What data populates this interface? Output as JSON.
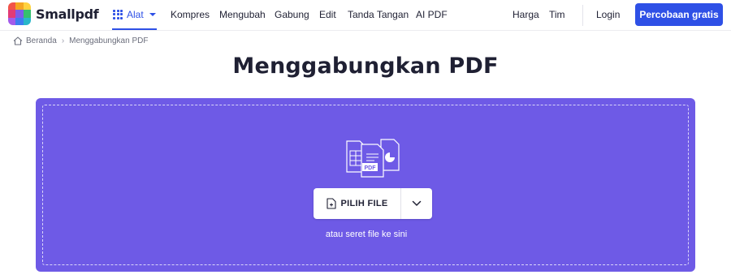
{
  "header": {
    "logo_text": "Smallpdf",
    "tools_label": "Alat",
    "nav": [
      "Kompres",
      "Mengubah",
      "Gabung",
      "Edit",
      "Tanda Tangan",
      "AI PDF"
    ],
    "right_links": [
      "Harga",
      "Tim"
    ],
    "login_label": "Login",
    "cta_label": "Percobaan gratis"
  },
  "breadcrumb": {
    "home": "Beranda",
    "current": "Menggabungkan PDF"
  },
  "page_title": "Menggabungkan PDF",
  "dropzone": {
    "illustration_badge": "PDF",
    "upload_label": "PILIH FILE",
    "hint": "atau seret file ke sini"
  },
  "colors": {
    "accent": "#2e50e6",
    "dropzone_bg": "#6e5ae6",
    "text": "#1f2033"
  },
  "icons": [
    "smallpdf-logo-icon",
    "grid-icon",
    "chevron-down-icon",
    "home-icon",
    "documents-illustration-icon",
    "file-add-icon"
  ]
}
